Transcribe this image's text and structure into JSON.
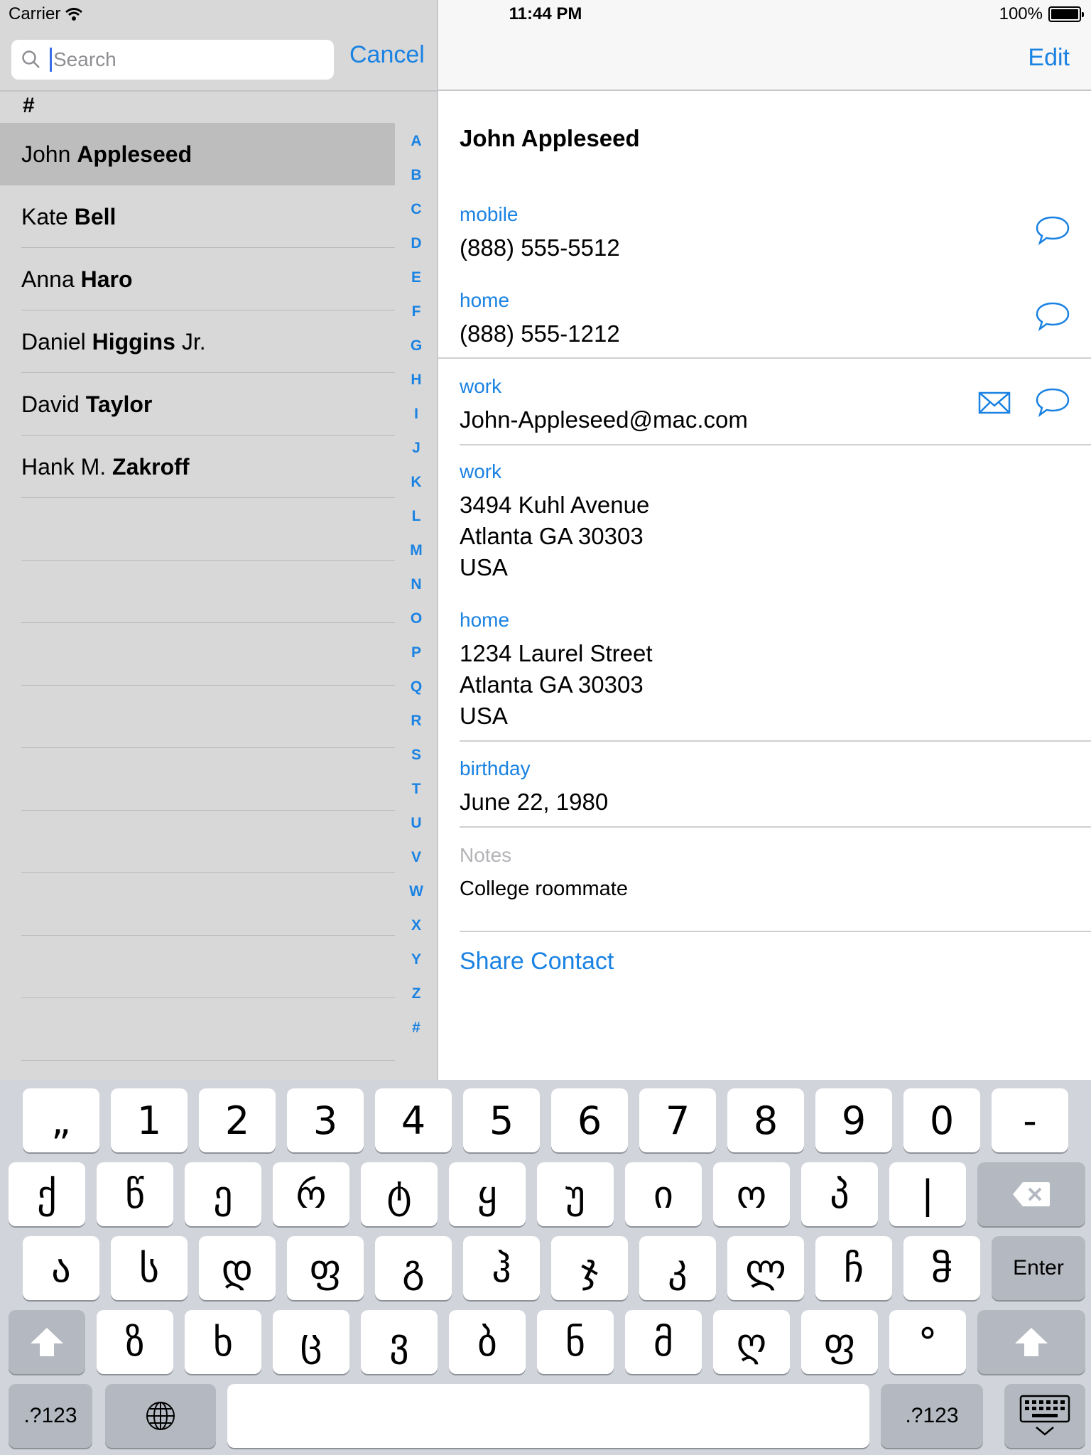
{
  "status_bar": {
    "carrier": "Carrier",
    "time": "11:44 PM",
    "battery": "100%"
  },
  "search": {
    "placeholder": "Search",
    "cancel_label": "Cancel"
  },
  "contacts": {
    "section": "#",
    "items": [
      {
        "first": "John",
        "last": "Appleseed",
        "suffix": ""
      },
      {
        "first": "Kate",
        "last": "Bell",
        "suffix": ""
      },
      {
        "first": "Anna",
        "last": "Haro",
        "suffix": ""
      },
      {
        "first": "Daniel",
        "last": "Higgins",
        "suffix": "Jr."
      },
      {
        "first": "David",
        "last": "Taylor",
        "suffix": ""
      },
      {
        "first": "Hank M.",
        "last": "Zakroff",
        "suffix": ""
      }
    ],
    "selected_index": 0
  },
  "index_letters": [
    "A",
    "B",
    "C",
    "D",
    "E",
    "F",
    "G",
    "H",
    "I",
    "J",
    "K",
    "L",
    "M",
    "N",
    "O",
    "P",
    "Q",
    "R",
    "S",
    "T",
    "U",
    "V",
    "W",
    "X",
    "Y",
    "Z",
    "#"
  ],
  "detail": {
    "edit_label": "Edit",
    "name": "John Appleseed",
    "mobile_label": "mobile",
    "mobile_value": "(888) 555-5512",
    "home_phone_label": "home",
    "home_phone_value": "(888) 555-1212",
    "email_label": "work",
    "email_value": "John-Appleseed@mac.com",
    "work_address_label": "work",
    "work_address": [
      "3494 Kuhl Avenue",
      "Atlanta GA 30303",
      "USA"
    ],
    "home_address_label": "home",
    "home_address": [
      "1234 Laurel Street",
      "Atlanta GA 30303",
      "USA"
    ],
    "birthday_label": "birthday",
    "birthday_value": "June 22, 1980",
    "notes_label": "Notes",
    "notes_value": "College roommate",
    "share_label": "Share Contact"
  },
  "keyboard": {
    "row1": [
      "„",
      "1",
      "2",
      "3",
      "4",
      "5",
      "6",
      "7",
      "8",
      "9",
      "0",
      "-"
    ],
    "row2": [
      "ქ",
      "წ",
      "ე",
      "რ",
      "ტ",
      "ყ",
      "უ",
      "ი",
      "ო",
      "პ",
      "|"
    ],
    "row3": [
      "ა",
      "ს",
      "დ",
      "ფ",
      "გ",
      "ჰ",
      "ჯ",
      "კ",
      "ლ",
      "ჩ",
      "ჵ"
    ],
    "row4": [
      "ზ",
      "ხ",
      "ც",
      "ვ",
      "ბ",
      "ნ",
      "მ",
      "ღ",
      "ფ",
      "°"
    ],
    "enter_label": "Enter",
    "numbers_label": ".?123"
  },
  "colors": {
    "accent": "#1a82e2",
    "keyboard_bg": "#d1d5db",
    "selected_row": "#bdbdbd"
  },
  "icons": [
    "wifi-icon",
    "battery-icon",
    "search-icon",
    "message-icon",
    "mail-icon",
    "backspace-icon",
    "shift-icon",
    "globe-icon",
    "keyboard-dismiss-icon"
  ]
}
